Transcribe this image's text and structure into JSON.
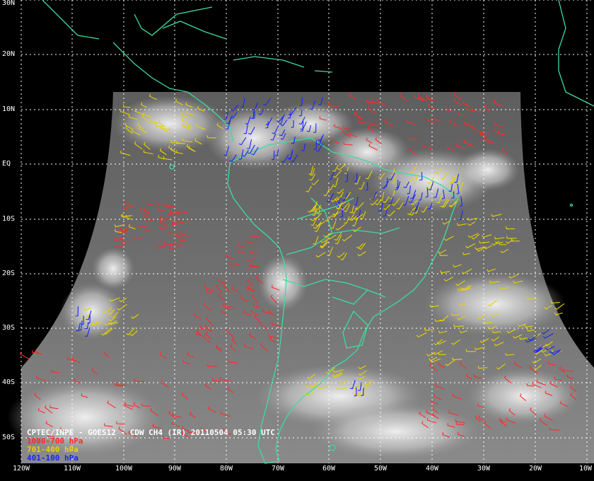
{
  "map": {
    "title": "CPTEC/INPE - GOES12 - CDW CH4 (IR) 20110504 05:30 UTC",
    "lat_labels": [
      "30N",
      "20N",
      "10N",
      "EQ",
      "10S",
      "20S",
      "30S",
      "40S",
      "50S"
    ],
    "lon_labels": [
      "120W",
      "110W",
      "100W",
      "90W",
      "80W",
      "70W",
      "60W",
      "50W",
      "40W",
      "30W",
      "20W",
      "10W"
    ],
    "legend": [
      {
        "label": "1000-700 hPa",
        "color": "#ff2a2a"
      },
      {
        "label": "701-400 hPa",
        "color": "#e6d200"
      },
      {
        "label": "401-100 hPa",
        "color": "#1a24ff"
      }
    ],
    "colors": {
      "background": "#000000",
      "coastline": "#3ddca0",
      "grid": "#ffffff",
      "satellite_gray": "#6e6e6e",
      "clouds": "#e8e8e8"
    }
  }
}
